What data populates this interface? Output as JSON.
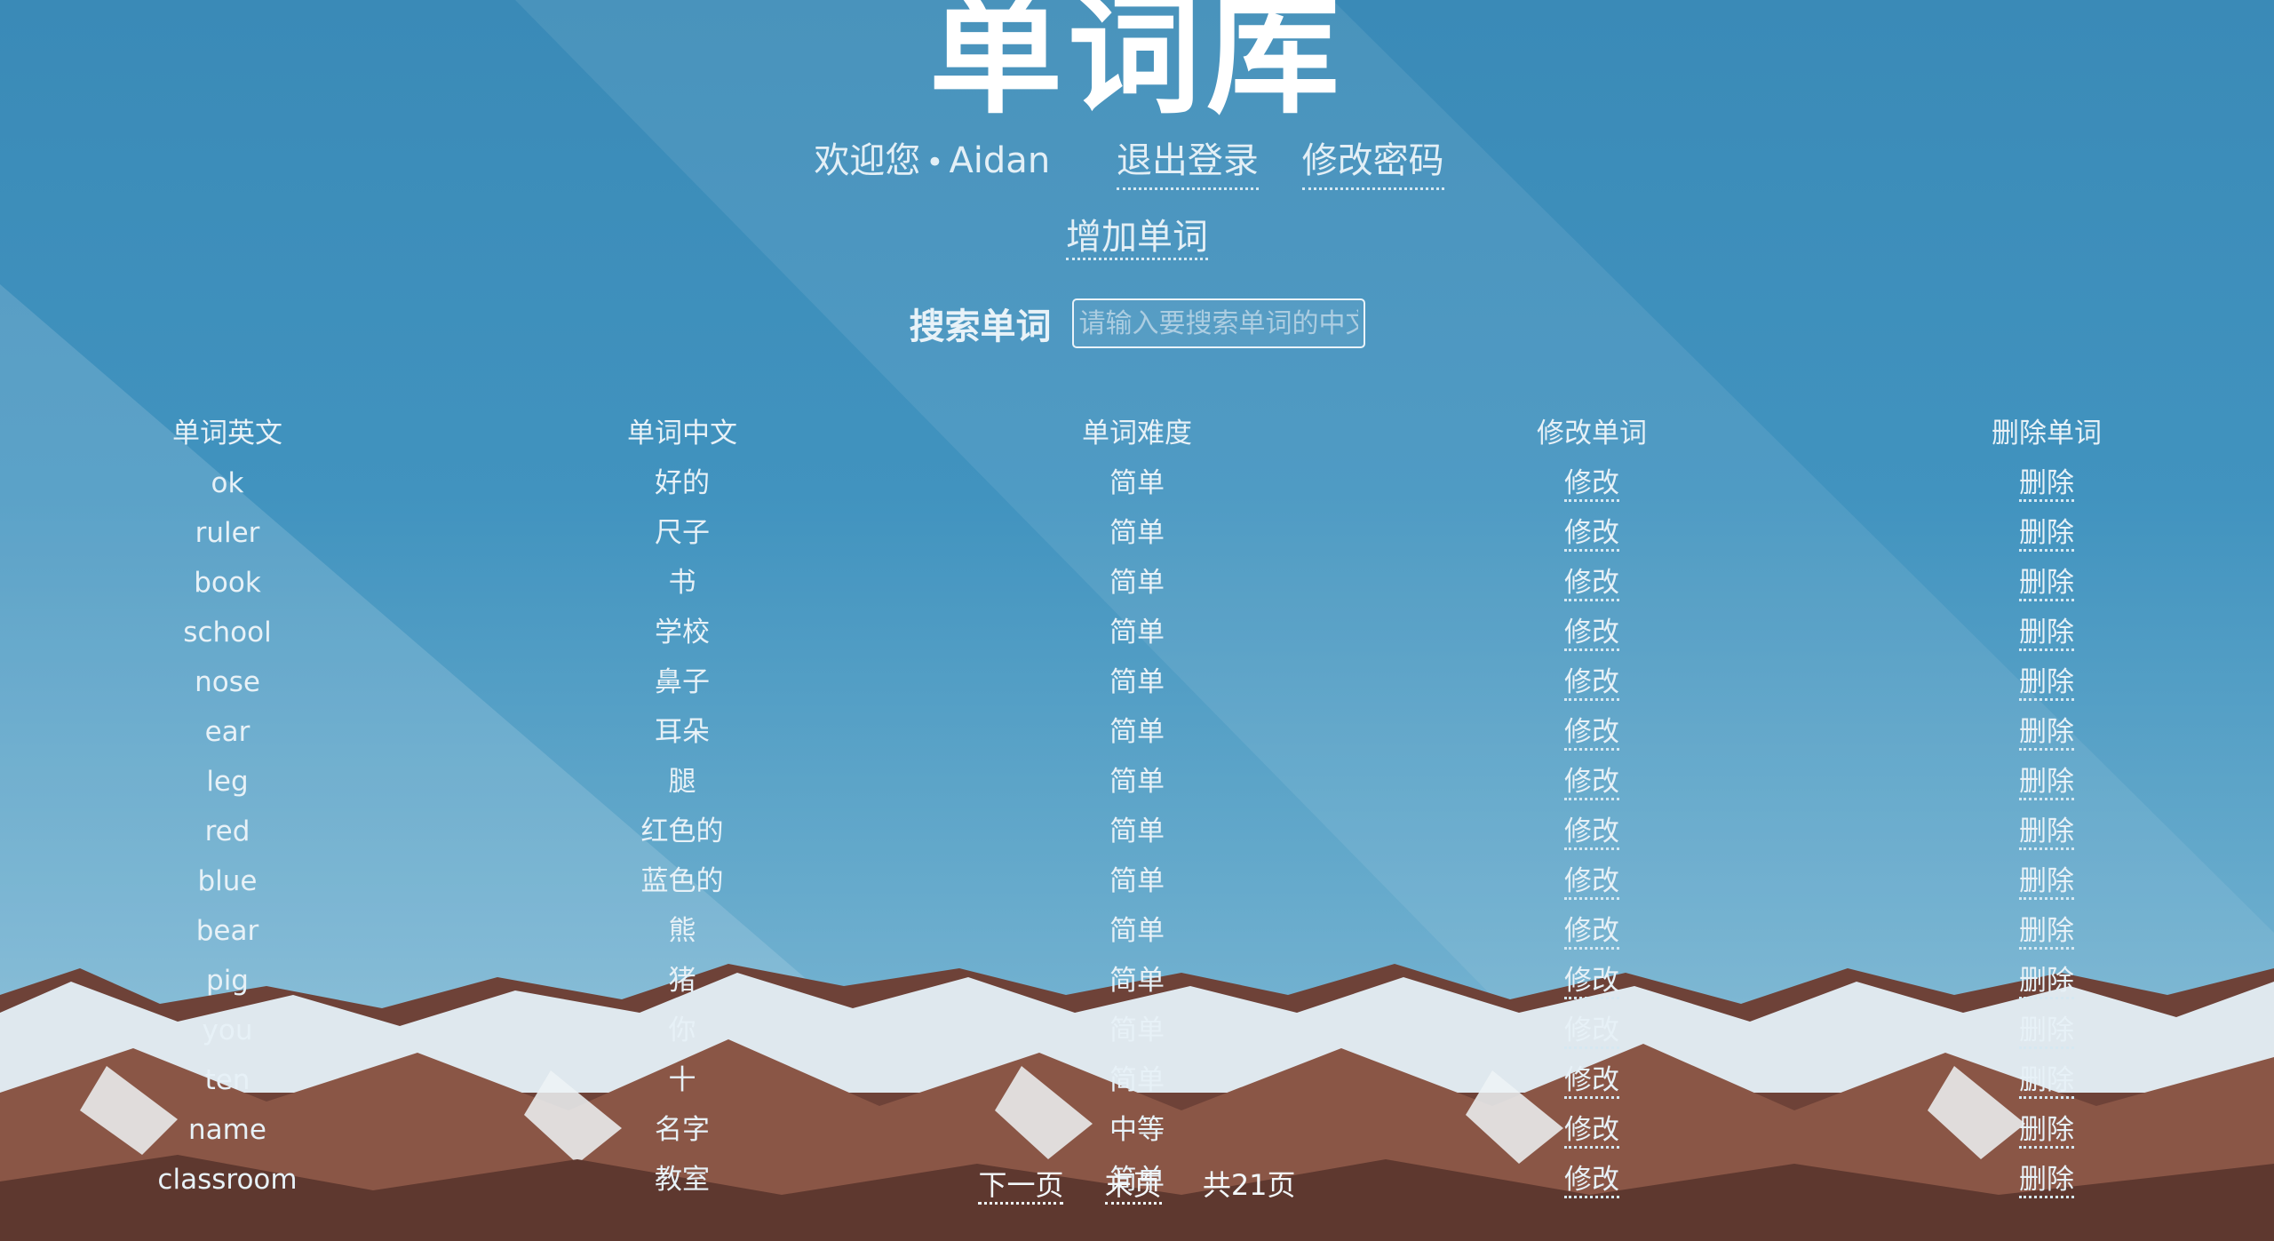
{
  "page": {
    "title": "单词库"
  },
  "user": {
    "welcome": "欢迎您",
    "separator": "•",
    "name": "Aidan",
    "logout": "退出登录",
    "change_password": "修改密码"
  },
  "actions": {
    "add_word": "增加单词"
  },
  "search": {
    "label": "搜索单词",
    "placeholder": "请输入要搜索单词的中文"
  },
  "table": {
    "headers": [
      "单词英文",
      "单词中文",
      "单词难度",
      "修改单词",
      "删除单词"
    ],
    "rows": [
      {
        "en": "ok",
        "zh": "好的",
        "level": "简单",
        "edit": "修改",
        "del": "删除"
      },
      {
        "en": "ruler",
        "zh": "尺子",
        "level": "简单",
        "edit": "修改",
        "del": "删除"
      },
      {
        "en": "book",
        "zh": "书",
        "level": "简单",
        "edit": "修改",
        "del": "删除"
      },
      {
        "en": "school",
        "zh": "学校",
        "level": "简单",
        "edit": "修改",
        "del": "删除"
      },
      {
        "en": "nose",
        "zh": "鼻子",
        "level": "简单",
        "edit": "修改",
        "del": "删除"
      },
      {
        "en": "ear",
        "zh": "耳朵",
        "level": "简单",
        "edit": "修改",
        "del": "删除"
      },
      {
        "en": "leg",
        "zh": "腿",
        "level": "简单",
        "edit": "修改",
        "del": "删除"
      },
      {
        "en": "red",
        "zh": "红色的",
        "level": "简单",
        "edit": "修改",
        "del": "删除"
      },
      {
        "en": "blue",
        "zh": "蓝色的",
        "level": "简单",
        "edit": "修改",
        "del": "删除"
      },
      {
        "en": "bear",
        "zh": "熊",
        "level": "简单",
        "edit": "修改",
        "del": "删除"
      },
      {
        "en": "pig",
        "zh": "猪",
        "level": "简单",
        "edit": "修改",
        "del": "删除"
      },
      {
        "en": "you",
        "zh": "你",
        "level": "简单",
        "edit": "修改",
        "del": "删除"
      },
      {
        "en": "ten",
        "zh": "十",
        "level": "简单",
        "edit": "修改",
        "del": "删除"
      },
      {
        "en": "name",
        "zh": "名字",
        "level": "中等",
        "edit": "修改",
        "del": "删除"
      },
      {
        "en": "classroom",
        "zh": "教室",
        "level": "简单",
        "edit": "修改",
        "del": "删除"
      }
    ]
  },
  "pagination": {
    "next": "下一页",
    "last": "末页",
    "total": "共21页"
  },
  "colors": {
    "sky_top": "#3a8ab7",
    "sky_bottom": "#8bbfd9",
    "text": "#e7f1f7",
    "snow": "#e9eef2",
    "rock": "#7a4a3c"
  }
}
